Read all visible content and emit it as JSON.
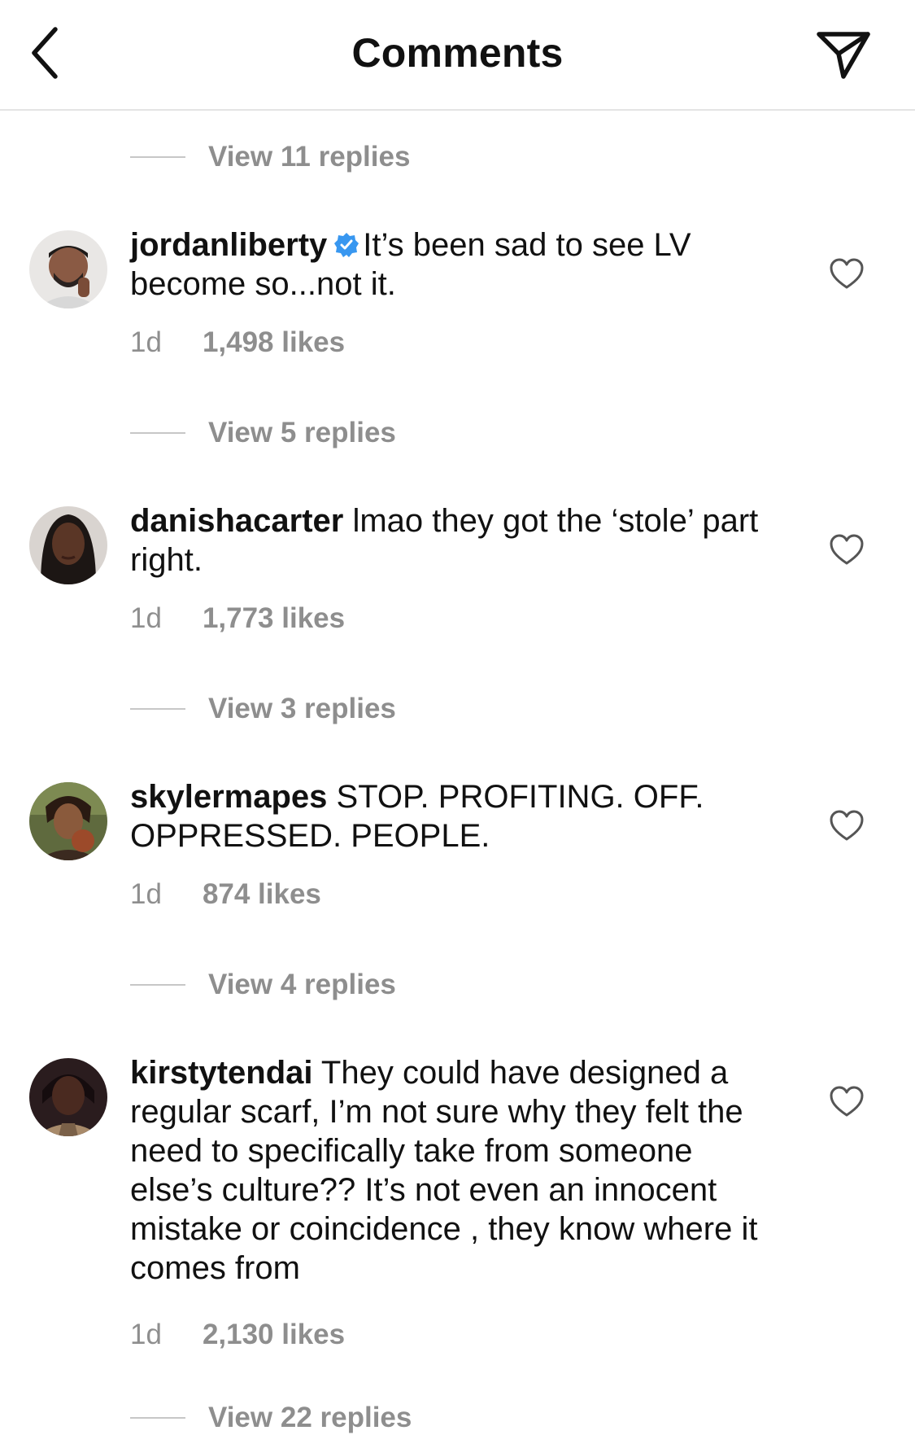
{
  "header": {
    "title": "Comments",
    "back_icon": "chevron-left-icon",
    "share_icon": "paper-plane-icon"
  },
  "replies_links": [
    {
      "label": "View 11 replies"
    },
    {
      "label": "View 5 replies"
    },
    {
      "label": "View 3 replies"
    },
    {
      "label": "View 4 replies"
    },
    {
      "label": "View 22 replies"
    }
  ],
  "comments": [
    {
      "username": "jordanliberty",
      "verified": true,
      "text": "It’s been sad to see LV become so...not it.",
      "time": "1d",
      "likes": "1,498 likes"
    },
    {
      "username": "danishacarter",
      "verified": false,
      "text": "lmao they got the ‘stole’ part right.",
      "time": "1d",
      "likes": "1,773 likes"
    },
    {
      "username": "skylermapes",
      "verified": false,
      "text": "STOP. PROFITING. OFF. OPPRESSED. PEOPLE.",
      "time": "1d",
      "likes": "874 likes"
    },
    {
      "username": "kirstytendai",
      "verified": false,
      "text": "They could have designed a regular scarf, I’m not sure why they felt the need to specifically take from someone else’s culture?? It’s not even an innocent mistake or coincidence , they know where it comes from",
      "time": "1d",
      "likes": "2,130 likes"
    }
  ],
  "colors": {
    "text": "#111111",
    "secondary": "#8e8e8e",
    "verified_blue": "#3897f0",
    "divider": "#e4e4e4"
  }
}
